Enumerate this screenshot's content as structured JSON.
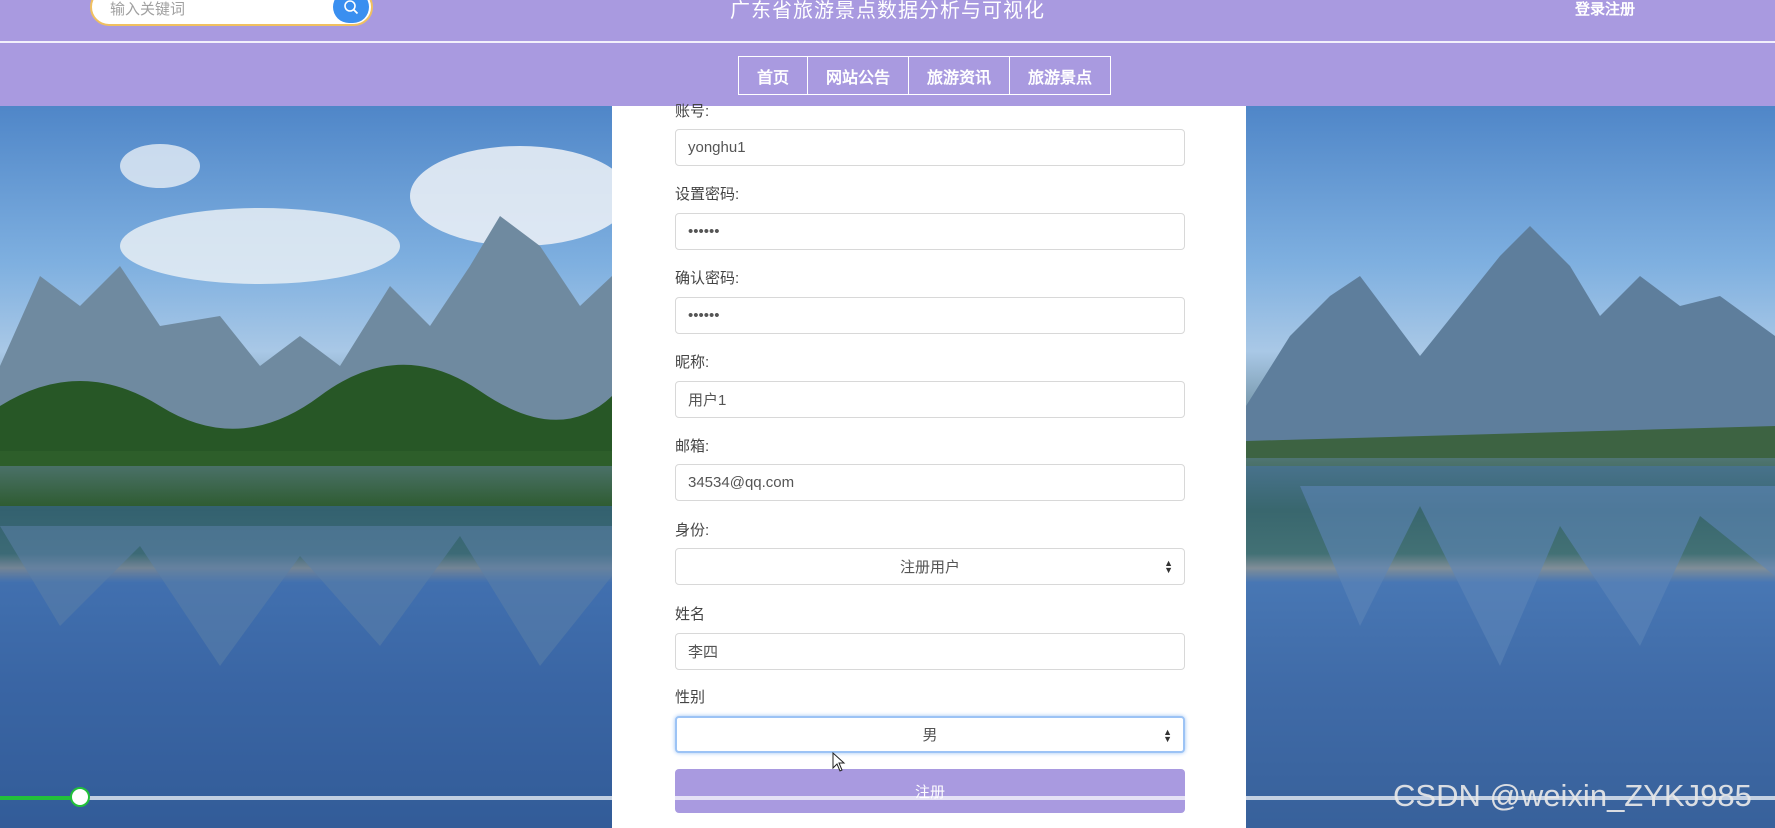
{
  "header": {
    "search_placeholder": "输入关键词",
    "title": "广东省旅游景点数据分析与可视化",
    "login_label": "登录注册"
  },
  "nav": {
    "items": [
      "首页",
      "网站公告",
      "旅游资讯",
      "旅游景点"
    ]
  },
  "form": {
    "account": {
      "label": "账号:",
      "value": "yonghu1"
    },
    "password": {
      "label": "设置密码:",
      "value": "••••••"
    },
    "confirm": {
      "label": "确认密码:",
      "value": "••••••"
    },
    "nickname": {
      "label": "昵称:",
      "value": "用户1"
    },
    "email": {
      "label": "邮箱:",
      "value": "34534@qq.com"
    },
    "role": {
      "label": "身份:",
      "value": "注册用户"
    },
    "name": {
      "label": "姓名",
      "value": "李四"
    },
    "gender": {
      "label": "性别",
      "value": "男"
    },
    "submit_label": "注册"
  },
  "video": {
    "progress": 0.045
  },
  "watermark": "CSDN @weixin_ZYKJ985",
  "colors": {
    "header": "#a99ae0",
    "search_button": "#3a8ff0",
    "progress": "#22c03a"
  }
}
